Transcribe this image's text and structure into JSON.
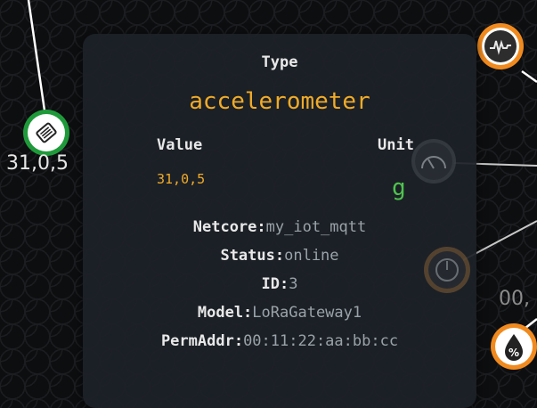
{
  "graph": {
    "node_accelerometer_label": "31,0,5",
    "node_percent_partial_label": "00,"
  },
  "panel": {
    "type_heading": "Type",
    "type_value": "accelerometer",
    "value_heading": "Value",
    "value_value": "31,0,5",
    "unit_heading": "Unit",
    "unit_value": "g",
    "info": [
      {
        "key": "Netcore:",
        "value": "my_iot_mqtt"
      },
      {
        "key": "Status:",
        "value": "online"
      },
      {
        "key": "ID:",
        "value": "3"
      },
      {
        "key": "Model:",
        "value": "LoRaGateway1"
      },
      {
        "key": "PermAddr:",
        "value": "00:11:22:aa:bb:cc"
      }
    ]
  },
  "colors": {
    "accent_orange": "#f0ab28",
    "unit_green": "#4fc34f",
    "node_green": "#1f9a3a",
    "node_orange": "#f08a1e"
  },
  "icons": {
    "accelerometer_node": "accelerometer-icon",
    "signal_node": "signal-wave-icon",
    "gauge_node_1": "gauge-icon",
    "gauge_node_2": "dial-gauge-icon",
    "percent_node": "humidity-percent-icon"
  }
}
